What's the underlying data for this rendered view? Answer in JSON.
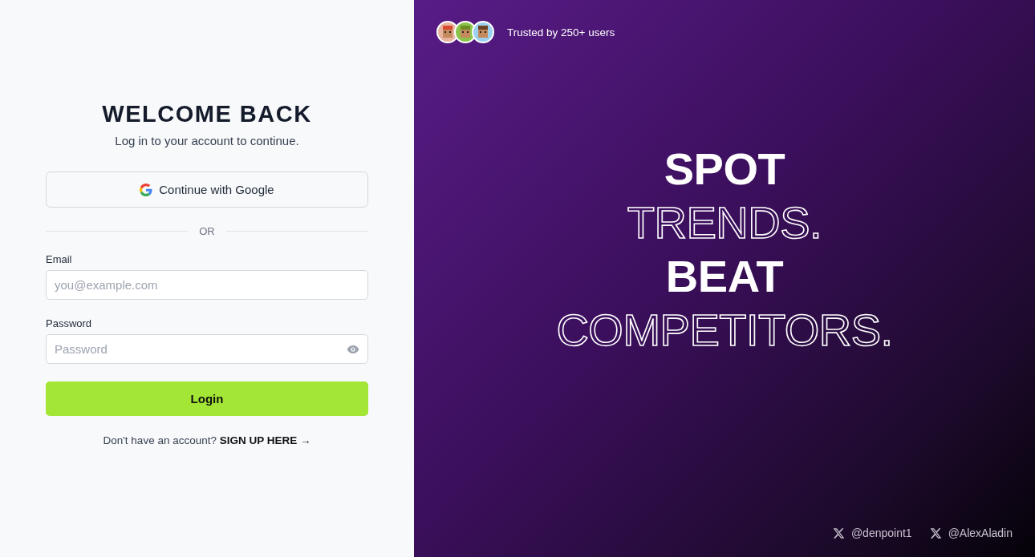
{
  "login": {
    "title": "WELCOME BACK",
    "subtitle": "Log in to your account to continue.",
    "google_button": "Continue with Google",
    "divider": "OR",
    "fields": [
      {
        "kind": "email",
        "label": "Email",
        "placeholder": "you@example.com"
      },
      {
        "kind": "password",
        "label": "Password",
        "placeholder": "Password"
      }
    ],
    "submit": "Login",
    "signup_prompt": "Don't have an account?",
    "signup_link": "SIGN UP HERE →"
  },
  "hero": {
    "trust_text": "Trusted by 250+ users",
    "headline": [
      {
        "text": "SPOT",
        "kind": "solid"
      },
      {
        "text": "TRENDS.",
        "kind": "outline"
      },
      {
        "text": "BEAT",
        "kind": "solid"
      },
      {
        "text": "COMPETITORS.",
        "kind": "outline"
      }
    ],
    "social": [
      "@denpoint1",
      "@AlexAladin"
    ]
  }
}
